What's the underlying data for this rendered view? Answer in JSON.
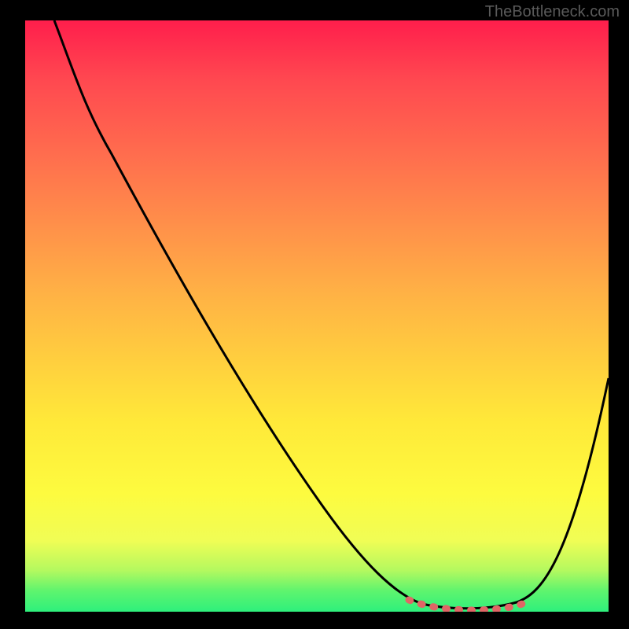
{
  "watermark": "TheBottleneck.com",
  "chart_data": {
    "type": "line",
    "title": "",
    "xlabel": "",
    "ylabel": "",
    "xlim": [
      0,
      100
    ],
    "ylim": [
      0,
      100
    ],
    "gradient_stops": [
      {
        "pct": 0,
        "color": "#ff1e4c"
      },
      {
        "pct": 10,
        "color": "#ff4850"
      },
      {
        "pct": 22,
        "color": "#ff6b4e"
      },
      {
        "pct": 34,
        "color": "#ff8e4a"
      },
      {
        "pct": 46,
        "color": "#ffb145"
      },
      {
        "pct": 58,
        "color": "#ffd03e"
      },
      {
        "pct": 68,
        "color": "#ffe939"
      },
      {
        "pct": 80,
        "color": "#fdfb3f"
      },
      {
        "pct": 88,
        "color": "#f0fd55"
      },
      {
        "pct": 93,
        "color": "#b4f95f"
      },
      {
        "pct": 96.5,
        "color": "#5ef46e"
      },
      {
        "pct": 100,
        "color": "#2ef07c"
      }
    ],
    "series": [
      {
        "name": "bottleneck-curve",
        "color": "#000000",
        "x": [
          5,
          10,
          15,
          20,
          25,
          30,
          35,
          40,
          45,
          50,
          55,
          60,
          65,
          70,
          75,
          80,
          85,
          90,
          95,
          100
        ],
        "values": [
          100,
          94,
          86,
          78,
          70,
          62,
          54,
          46,
          38,
          30,
          22,
          14,
          7,
          3,
          1,
          0.5,
          2,
          10,
          24,
          40
        ]
      }
    ],
    "highlight_segment": {
      "name": "optimal-range",
      "color": "#e57373",
      "x_start": 66,
      "x_end": 86,
      "style": "dashed-thick"
    }
  }
}
